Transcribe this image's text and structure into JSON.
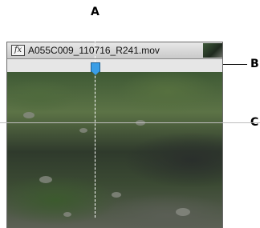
{
  "callouts": {
    "a": "A",
    "b": "B",
    "c": "C"
  },
  "clip": {
    "effects_badge": "fx",
    "name": "A055C009_110716_R241.mov"
  },
  "playhead": {
    "color": "#3a9ee6"
  },
  "icons": {
    "effects": "fx-icon",
    "thumbnail": "clip-thumbnail"
  }
}
